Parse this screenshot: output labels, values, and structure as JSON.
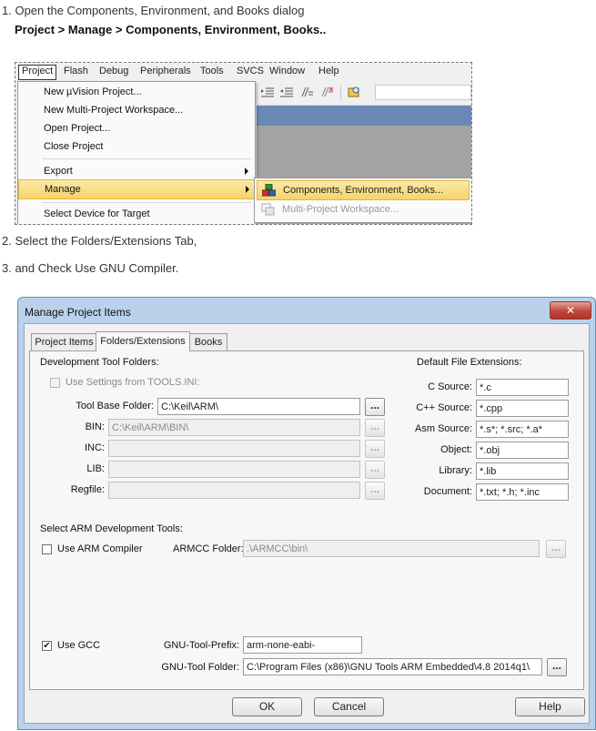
{
  "steps": {
    "step1": "1. Open the Components, Environment, and Books dialog",
    "step1_path": "Project > Manage > Components, Environment, Books..",
    "step2": "2. Select the Folders/Extensions Tab,",
    "step3": "3. and Check Use GNU Compiler."
  },
  "menu_shot": {
    "menubar": [
      "Project",
      "Flash",
      "Debug",
      "Peripherals",
      "Tools",
      "SVCS",
      "Window",
      "Help"
    ],
    "project_menu": {
      "new_project": "New µVision Project...",
      "new_multi": "New Multi-Project Workspace...",
      "open_project": "Open Project...",
      "close_project": "Close Project",
      "export": "Export",
      "manage": "Manage",
      "select_device": "Select Device for Target"
    },
    "manage_submenu": {
      "components": "Components, Environment, Books...",
      "multi_workspace": "Multi-Project Workspace..."
    },
    "highlight_color": "#f5d46a"
  },
  "dialog": {
    "title": "Manage Project Items",
    "close_glyph": "✕",
    "tabs": [
      "Project Items",
      "Folders/Extensions",
      "Books"
    ],
    "active_tab": "Folders/Extensions",
    "dev_tool_folders": {
      "heading": "Development Tool Folders:",
      "use_settings_label": "Use Settings from TOOLS.INI:",
      "use_settings_checked": false,
      "tool_base_label": "Tool Base Folder:",
      "tool_base_value": "C:\\Keil\\ARM\\",
      "bin_label": "BIN:",
      "bin_value": "C:\\Keil\\ARM\\BIN\\",
      "inc_label": "INC:",
      "inc_value": "",
      "lib_label": "LIB:",
      "lib_value": "",
      "regfile_label": "Regfile:",
      "regfile_value": "",
      "browse_label": "..."
    },
    "file_extensions": {
      "heading": "Default File Extensions:",
      "c_label": "C Source:",
      "c_value": "*.c",
      "cpp_label": "C++ Source:",
      "cpp_value": "*.cpp",
      "asm_label": "Asm Source:",
      "asm_value": "*.s*; *.src; *.a*",
      "obj_label": "Object:",
      "obj_value": "*.obj",
      "lib_label": "Library:",
      "lib_value": "*.lib",
      "doc_label": "Document:",
      "doc_value": "*.txt; *.h; *.inc"
    },
    "arm_tools": {
      "heading": "Select ARM Development Tools:",
      "use_arm_label": "Use ARM Compiler",
      "use_arm_checked": false,
      "armcc_label": "ARMCC Folder:",
      "armcc_value": ".\\ARMCC\\bin\\",
      "use_gcc_label": "Use GCC",
      "use_gcc_checked": true,
      "check_glyph": "✔",
      "prefix_label": "GNU-Tool-Prefix:",
      "prefix_value": "arm-none-eabi-",
      "gnu_folder_label": "GNU-Tool Folder:",
      "gnu_folder_value": "C:\\Program Files (x86)\\GNU Tools ARM Embedded\\4.8 2014q1\\"
    },
    "buttons": {
      "ok": "OK",
      "cancel": "Cancel",
      "help": "Help"
    }
  }
}
